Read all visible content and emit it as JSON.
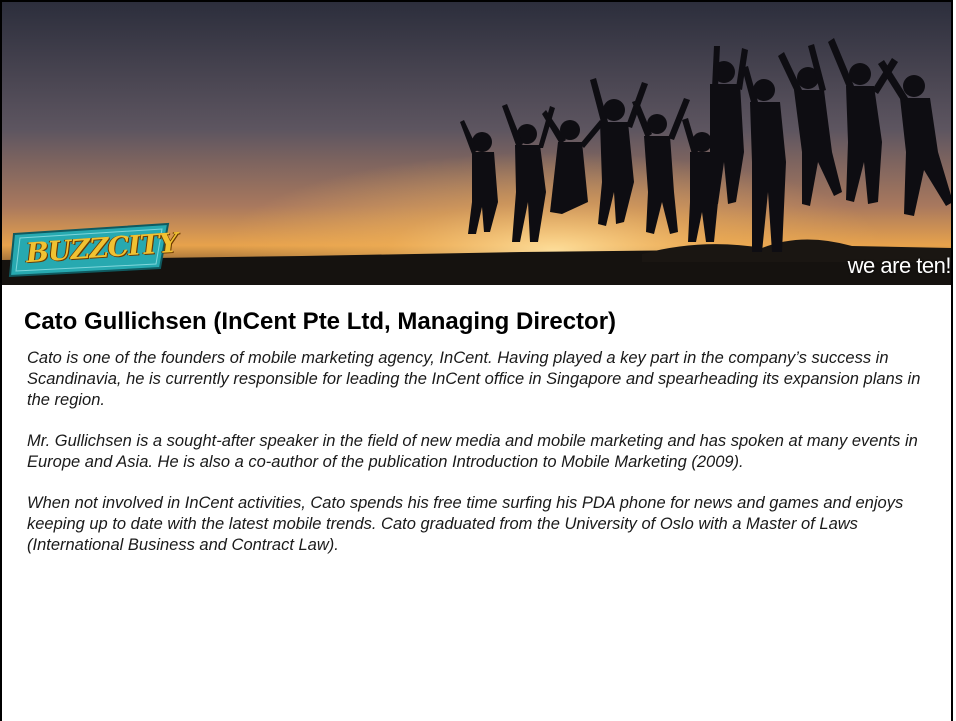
{
  "banner": {
    "tagline": "we are ten!",
    "logo_text": "BUZZCITY",
    "colors": {
      "sky_top": "#2f3140",
      "sky_mid": "#6a5e63",
      "horizon": "#e9a14a",
      "glow": "#f6d08a",
      "silhouette": "#0e0d12",
      "logo_teal": "#27a9b0",
      "logo_gold": "#f1c232"
    }
  },
  "content": {
    "title": "Cato Gullichsen (InCent Pte Ltd, Managing Director)",
    "paragraphs": [
      "Cato is one of the founders of mobile marketing agency, InCent. Having played a key part in the company’s success in Scandinavia, he is currently responsible for leading the InCent office in Singapore and spearheading its expansion plans in the region.",
      "Mr. Gullichsen is a sought-after speaker in the field of new media and mobile marketing and has spoken at many events in Europe and Asia. He is also a co-author of the publication Introduction to Mobile Marketing (2009).",
      "When not involved in InCent activities, Cato spends his free time surfing his PDA phone for news and games and enjoys keeping up to date with the latest mobile trends. Cato graduated from the University of Oslo with a Master of Laws (International Business and Contract Law)."
    ]
  }
}
